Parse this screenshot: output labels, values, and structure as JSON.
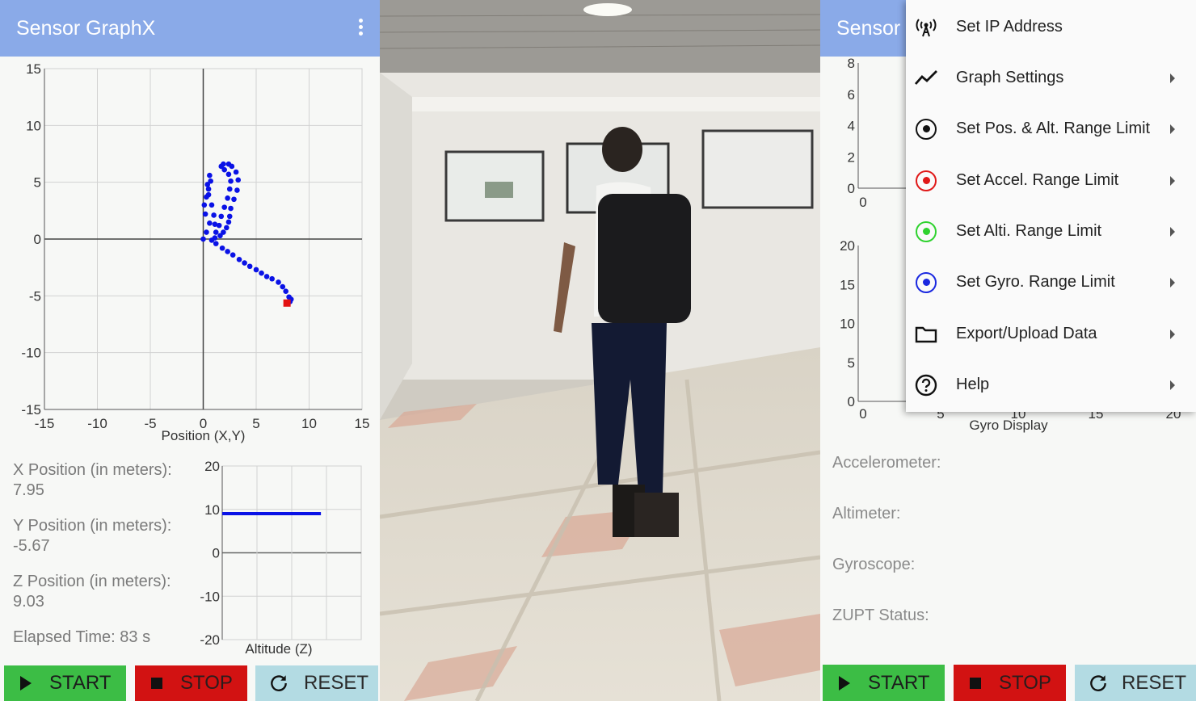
{
  "app": {
    "title": "Sensor GraphX",
    "title_truncated": "Sensor"
  },
  "colors": {
    "appbar": "#8aaae8",
    "trajectory": "#0a12e6",
    "end_marker": "#e31212",
    "start_btn": "#3cbd45",
    "stop_btn": "#d21212",
    "reset_btn": "#b3dbe3"
  },
  "left": {
    "xy_chart": {
      "xlabel": "Position (X,Y)",
      "x_ticks": [
        "-15",
        "-10",
        "-5",
        "0",
        "5",
        "10",
        "15"
      ],
      "y_ticks": [
        "15",
        "10",
        "5",
        "0",
        "-5",
        "-10",
        "-15"
      ]
    },
    "info": {
      "x_label": "X Position (in meters):",
      "x_value": "7.95",
      "y_label": "Y Position (in meters):",
      "y_value": "-5.67",
      "z_label": "Z Position (in meters):",
      "z_value": "9.03",
      "elapsed": "Elapsed Time: 83 s"
    },
    "alt_chart": {
      "xlabel": "Altitude (Z)",
      "y_ticks": [
        "20",
        "10",
        "0",
        "-10",
        "-20"
      ]
    },
    "buttons": {
      "start": "START",
      "stop": "STOP",
      "reset": "RESET"
    }
  },
  "right": {
    "accel_chart": {
      "y_ticks": [
        "8",
        "6",
        "4",
        "2",
        "0"
      ],
      "x_tick_first": "0"
    },
    "gyro_chart": {
      "xlabel": "Gyro Display",
      "y_ticks": [
        "20",
        "15",
        "10",
        "5",
        "0"
      ],
      "x_ticks": [
        "0",
        "5",
        "10",
        "15",
        "20"
      ]
    },
    "sensors": {
      "accel": "Accelerometer:",
      "alti": "Altimeter:",
      "gyro": "Gyroscope:",
      "zupt": "ZUPT Status:"
    },
    "buttons": {
      "start": "START",
      "stop": "STOP",
      "reset": "RESET"
    },
    "menu": [
      {
        "label": "Set IP Address",
        "icon": "antenna-icon"
      },
      {
        "label": "Graph Settings",
        "icon": "line-chart-icon"
      },
      {
        "label": "Set Pos. & Alt. Range Limit",
        "icon": "target-icon",
        "color": "#111111"
      },
      {
        "label": "Set Accel. Range Limit",
        "icon": "target-icon",
        "color": "#e01818"
      },
      {
        "label": "Set Alti. Range Limit",
        "icon": "target-icon",
        "color": "#2fd22f"
      },
      {
        "label": "Set Gyro. Range Limit",
        "icon": "target-icon",
        "color": "#1a28e0"
      },
      {
        "label": "Export/Upload Data",
        "icon": "folder-icon"
      },
      {
        "label": "Help",
        "icon": "help-icon"
      }
    ]
  },
  "chart_data": [
    {
      "type": "scatter",
      "xlabel": "Position (X,Y)",
      "xlim": [
        -15,
        15
      ],
      "ylim": [
        -15,
        15
      ],
      "grid": true,
      "series": [
        {
          "x": [
            0,
            0.3,
            0.6,
            0.2,
            0.1,
            0.3,
            0.5,
            0.7,
            0.6,
            0.4,
            0.5,
            0.8,
            1.0,
            1.1,
            1.2,
            1.5,
            1.7,
            2.0,
            2.3,
            2.5,
            2.6,
            2.4,
            2.0,
            1.7,
            1.9,
            2.4,
            2.7,
            3.1,
            3.3,
            3.2,
            2.9,
            2.6,
            2.5,
            2.4,
            2.2,
            1.9,
            1.6,
            1.1,
            0.8,
            1.2,
            1.8,
            2.3,
            2.8,
            3.4,
            3.9,
            4.4,
            5.0,
            5.5,
            6.0,
            6.5,
            7.1,
            7.5,
            7.8,
            8.1,
            8.3,
            8.2,
            8.0,
            7.95
          ],
          "y": [
            0,
            0.6,
            1.4,
            2.2,
            3.0,
            3.7,
            4.4,
            5.1,
            5.6,
            4.8,
            3.9,
            3.0,
            2.1,
            1.3,
            0.6,
            1.2,
            2.0,
            2.8,
            3.6,
            4.4,
            5.1,
            5.7,
            6.1,
            6.4,
            6.6,
            6.6,
            6.4,
            5.9,
            5.2,
            4.3,
            3.5,
            2.7,
            2.0,
            1.5,
            1.0,
            0.6,
            0.3,
            0.1,
            -0.1,
            -0.4,
            -0.8,
            -1.1,
            -1.4,
            -1.8,
            -2.1,
            -2.4,
            -2.7,
            -3.0,
            -3.3,
            -3.5,
            -3.8,
            -4.2,
            -4.6,
            -5.1,
            -5.3,
            -5.5,
            -5.6,
            -5.67
          ]
        }
      ],
      "end_point": {
        "x": 7.95,
        "y": -5.67
      }
    },
    {
      "type": "line",
      "xlabel": "Altitude (Z)",
      "ylim": [
        -20,
        20
      ],
      "grid": true,
      "series": [
        {
          "x": [
            0,
            1
          ],
          "y": [
            9.03,
            9.03
          ]
        }
      ]
    },
    {
      "type": "line",
      "ylim": [
        0,
        8
      ],
      "grid": true,
      "series": []
    },
    {
      "type": "line",
      "xlabel": "Gyro Display",
      "xlim": [
        0,
        20
      ],
      "ylim": [
        0,
        20
      ],
      "grid": true,
      "series": []
    }
  ]
}
